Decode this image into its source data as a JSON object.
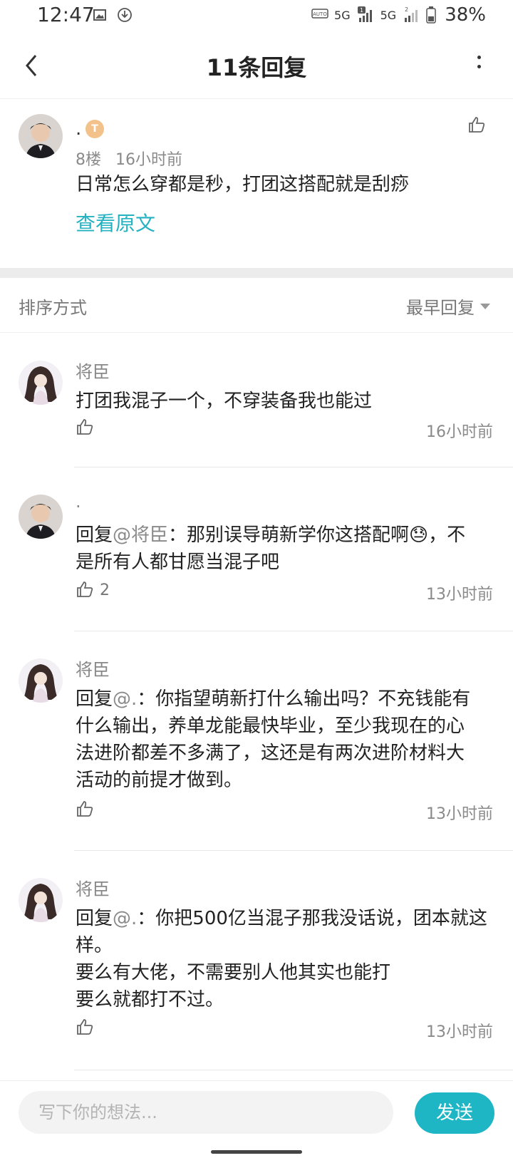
{
  "status_bar": {
    "time": "12:47",
    "net1": "5G",
    "net2": "5G",
    "sim1_badge": "1",
    "sim2_badge": "2",
    "battery": "38%"
  },
  "nav": {
    "title": "11条回复"
  },
  "original_post": {
    "username": ".",
    "level": "T",
    "floor": "8楼",
    "time": "16小时前",
    "content": "日常怎么穿都是秒，打团这搭配就是刮痧",
    "view_original": "查看原文"
  },
  "sort": {
    "label": "排序方式",
    "value": "最早回复"
  },
  "replies": [
    {
      "username": "将臣",
      "mention": "",
      "content": "打团我混子一个，不穿装备我也能过",
      "like_count": "",
      "time": "16小时前"
    },
    {
      "username": ".",
      "prefix": "回复",
      "mention": "@将臣",
      "content": "：那别误导萌新学你这搭配啊😓，不是所有人都甘愿当混子吧",
      "like_count": "2",
      "time": "13小时前"
    },
    {
      "username": "将臣",
      "prefix": "回复",
      "mention": "@.",
      "content": "：你指望萌新打什么输出吗？不充钱能有什么输出，养单龙能最快毕业，至少我现在的心法进阶都差不多满了，这还是有两次进阶材料大活动的前提才做到。",
      "like_count": "",
      "time": "13小时前"
    },
    {
      "username": "将臣",
      "prefix": "回复",
      "mention": "@.",
      "content": "：你把500亿当混子那我没话说，团本就这样。",
      "content_line2": "要么有大佬，不需要别人他其实也能打",
      "content_line3": "要么就都打不过。",
      "like_count": "",
      "time": "13小时前"
    }
  ],
  "composer": {
    "placeholder": "写下你的想法...",
    "send": "发送"
  },
  "colors": {
    "accent": "#1eb6c4",
    "link": "#25b2c0"
  }
}
